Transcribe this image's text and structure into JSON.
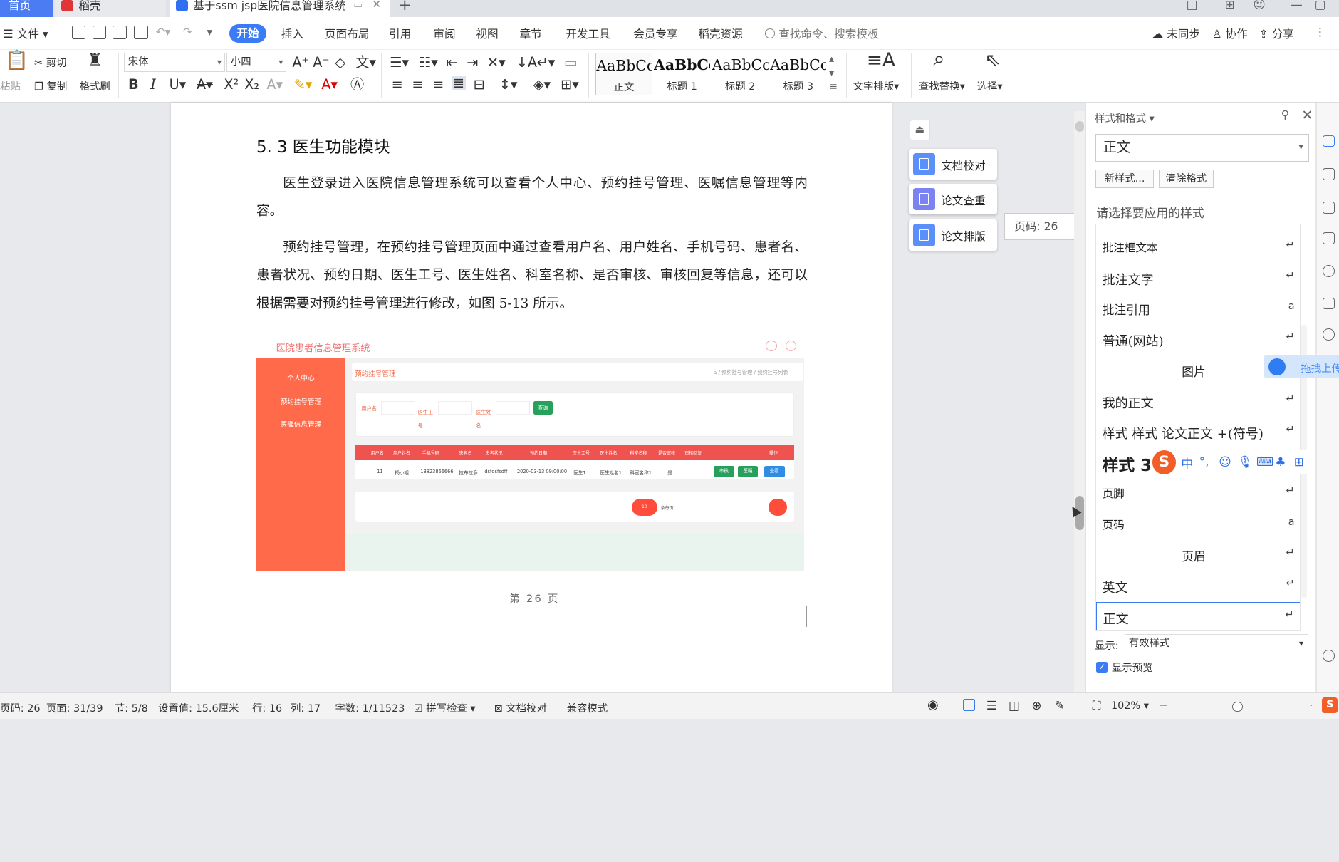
{
  "tabs": {
    "home": "首页",
    "daoke": "稻壳",
    "doc": "基于ssm jsp医院信息管理系统"
  },
  "menu": {
    "file": "文件",
    "items": [
      "开始",
      "插入",
      "页面布局",
      "引用",
      "审阅",
      "视图",
      "章节",
      "开发工具",
      "会员专享",
      "稻壳资源"
    ],
    "search_placeholder": "查找命令、搜索模板",
    "sync": "未同步",
    "collab": "协作",
    "share": "分享"
  },
  "ribbon": {
    "paste": "粘贴",
    "cut": "剪切",
    "copy": "复制",
    "format_painter": "格式刷",
    "font_name": "宋体",
    "font_size": "小四",
    "styles": [
      {
        "preview": "AaBbCcD",
        "name": "正文"
      },
      {
        "preview": "AaBbCcI",
        "name": "标题 1"
      },
      {
        "preview": "AaBbCcI",
        "name": "标题 2"
      },
      {
        "preview": "AaBbCc",
        "name": "标题 3"
      }
    ],
    "text_layout": "文字排版",
    "find_replace": "查找替换",
    "select": "选择"
  },
  "document": {
    "section_title": "5. 3 医生功能模块",
    "para1": "医生登录进入医院信息管理系统可以查看个人中心、预约挂号管理、医嘱信息管理等内容。",
    "para2": "预约挂号管理，在预约挂号管理页面中通过查看用户名、用户姓名、手机号码、患者名、患者状况、预约日期、医生工号、医生姓名、科室名称、是否审核、审核回复等信息，还可以根据需要对预约挂号管理进行修改，如图 5-13 所示。",
    "page_footer": "第 26 页",
    "screenshot": {
      "title": "医院患者信息管理系统",
      "sidebar": [
        "个人中心",
        "预约挂号管理",
        "医嘱信息管理"
      ],
      "breadcrumb_title": "预约挂号管理",
      "breadcrumb_path": "⌂ / 预约挂号管理 / 预约挂号列表",
      "search_labels": [
        "用户名",
        "医生工号",
        "医生姓名"
      ],
      "search_button": "查询",
      "table_headers": [
        "用户名",
        "用户姓名",
        "手机号码",
        "患者名",
        "患者状况",
        "预约日期",
        "医生工号",
        "医生姓名",
        "科室名称",
        "是否审核",
        "审核回复",
        "操作"
      ],
      "row": [
        "11",
        "杨小姐",
        "13823866666",
        "拉布拉多",
        "dsfdsfsdff",
        "2020-03-13 09:00:00",
        "医生1",
        "医生姓名1",
        "科室名称1",
        "是"
      ],
      "row_buttons": [
        "审核",
        "医嘱",
        "查看"
      ],
      "pager": [
        "10",
        "条每页"
      ]
    }
  },
  "float_panel": {
    "proof": "文档校对",
    "plagiarism": "论文查重",
    "thesis_layout": "论文排版",
    "page_tooltip": "页码: 26"
  },
  "style_pane": {
    "title": "样式和格式",
    "current": "正文",
    "new_style": "新样式...",
    "clear_format": "清除格式",
    "choose_label": "请选择要应用的样式",
    "items": [
      {
        "label": "批注框文本",
        "mark": "↵"
      },
      {
        "label": "批注文字",
        "mark": "↵"
      },
      {
        "label": "批注引用",
        "mark": "a"
      },
      {
        "label": "普通(网站)",
        "mark": "↵"
      },
      {
        "label": "图片",
        "mark": "↵"
      },
      {
        "label": "我的正文",
        "mark": "↵"
      },
      {
        "label": "样式 样式 论文正文 +(符号)",
        "mark": "↵"
      },
      {
        "label": "样式 3",
        "mark": "↵"
      },
      {
        "label": "页脚",
        "mark": "↵"
      },
      {
        "label": "页码",
        "mark": "a"
      },
      {
        "label": "页眉",
        "mark": "↵"
      },
      {
        "label": "英文",
        "mark": "↵"
      },
      {
        "label": "正文",
        "mark": "↵"
      }
    ],
    "show_label": "显示:",
    "show_value": "有效样式",
    "preview_label": "显示预览"
  },
  "upload_badge": "拖拽上传",
  "ime": {
    "lang": "中"
  },
  "status": {
    "page_num": "页码: 26",
    "pages": "页面: 31/39",
    "section": "节: 5/8",
    "setting": "设置值: 15.6厘米",
    "row": "行: 16",
    "col": "列: 17",
    "words": "字数: 1/11523",
    "spell": "拼写检查",
    "proof": "文档校对",
    "compat": "兼容模式",
    "zoom": "102%"
  },
  "colors": {
    "accent": "#3b7cf6",
    "shot_sidebar": "#ff6a4a",
    "shot_table_head": "#ef5350"
  }
}
